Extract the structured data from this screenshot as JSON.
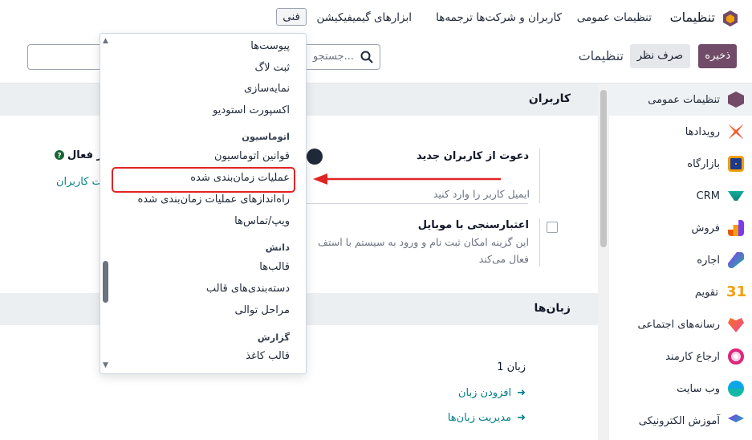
{
  "topnav": {
    "app_title": "تنظیمات",
    "items": [
      "تنظیمات عمومی",
      "کاربران و شرکت‌ها",
      "ترجمه‌ها",
      "ابزارهای گیمیفیکیشن",
      "فنی"
    ]
  },
  "control_bar": {
    "save_label": "ذخیره",
    "discard_label": "صرف نظر",
    "title": "تنظیمات",
    "search_placeholder": "جستجو..."
  },
  "sidebar": {
    "items": [
      {
        "label": "تنظیمات عمومی",
        "icon": "settings-app-icon",
        "color": "#714B67"
      },
      {
        "label": "رویدادها",
        "icon": "events-app-icon",
        "color": "#f97316"
      },
      {
        "label": "بازارگاه",
        "icon": "marketplace-app-icon",
        "color": "#1e3a8a"
      },
      {
        "label": "CRM",
        "icon": "crm-app-icon",
        "color": "#0d9488"
      },
      {
        "label": "فروش",
        "icon": "sales-app-icon",
        "color": "#ea580c"
      },
      {
        "label": "اجاره",
        "icon": "rental-app-icon",
        "color": "#9333ea"
      },
      {
        "label": "تقویم",
        "icon": "calendar-app-icon",
        "color": "#f59e0b"
      },
      {
        "label": "رسانه‌های اجتماعی",
        "icon": "social-media-app-icon",
        "color": "#f97316"
      },
      {
        "label": "ارجاع کارمند",
        "icon": "referral-app-icon",
        "color": "#db2777"
      },
      {
        "label": "وب سایت",
        "icon": "website-app-icon",
        "color": "#0ea5e9"
      },
      {
        "label": "آموزش الکترونیکی",
        "icon": "elearning-app-icon",
        "color": "#7c3aed"
      }
    ]
  },
  "main": {
    "users_section": {
      "title": "کاربران",
      "invite_title": "دعوت از کاربران جدید",
      "invite_placeholder": "ایمیل کاربر را وارد کنید",
      "active_users_fragment": "ر فعال",
      "manage_users_fragment": "یت کاربران",
      "mobile_auth_title": "اعتبارسنجی با موبایل",
      "mobile_auth_desc_line1": "این گزینه امکان ثبت نام و ورود به سیستم با استف",
      "mobile_auth_desc_line2": "فعال می‌کند"
    },
    "languages_section": {
      "title": "زبان‌ها",
      "count_text": "1 زبان",
      "add_language": "افزودن زبان",
      "manage_languages": "مدیریت زبان‌ها"
    }
  },
  "dropdown": {
    "items_top": [
      "پیوست‌ها",
      "ثبت لاگ",
      "نمایه‌سازی",
      "اکسپورت استودیو"
    ],
    "group_automation": "اتوماسیون",
    "automation_items": [
      "قوانین اتوماسیون",
      "عملیات زمان‌بندی شده",
      "راه‌اندازهای عملیات زمان‌بندی شده",
      "ویپ/تماس‌ها"
    ],
    "group_knowledge": "دانش",
    "knowledge_items": [
      "قالب‌ها",
      "دسته‌بندی‌های قالب",
      "مراحل توالی"
    ],
    "group_report": "گزارش",
    "report_items": [
      "قالب کاغذ"
    ]
  },
  "colors": {
    "brand": "#714B67",
    "link": "#017e84",
    "highlight": "#e02424"
  }
}
